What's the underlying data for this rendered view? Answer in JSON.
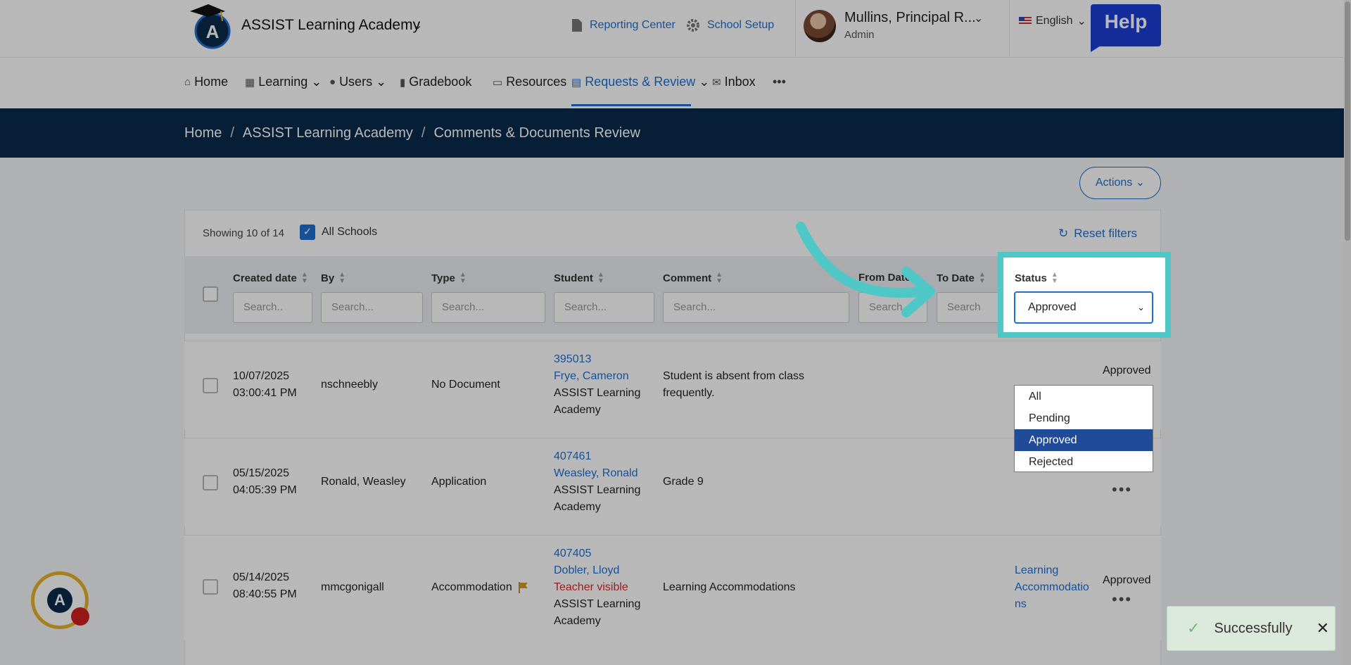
{
  "header": {
    "school_name": "ASSIST Learning Academy",
    "reporting_center": "Reporting Center",
    "school_setup": "School Setup",
    "user_name": "Mullins, Principal R...",
    "user_role": "Admin",
    "language": "English",
    "help": "Help"
  },
  "nav": {
    "home": "Home",
    "learning": "Learning",
    "users": "Users",
    "gradebook": "Gradebook",
    "resources": "Resources",
    "requests": "Requests & Review",
    "inbox": "Inbox",
    "more": "•••"
  },
  "breadcrumb": {
    "home": "Home",
    "school": "ASSIST Learning Academy",
    "page": "Comments & Documents Review",
    "sep": "/"
  },
  "toolbar": {
    "actions": "Actions",
    "showing": "Showing 10 of 14",
    "all_schools": "All Schools",
    "reset": "Reset filters"
  },
  "columns": {
    "created": "Created date",
    "by": "By",
    "type": "Type",
    "student": "Student",
    "comment": "Comment",
    "from_date": "From Date",
    "to_date": "To Date",
    "status": "Status"
  },
  "placeholders": {
    "created": "Search..",
    "by": "Search...",
    "type": "Search...",
    "student": "Search...",
    "comment": "Search...",
    "from_date": "Search...",
    "to_date": "Search"
  },
  "status_filter": {
    "value": "Approved",
    "options": [
      "All",
      "Pending",
      "Approved",
      "Rejected"
    ]
  },
  "rows": [
    {
      "date": "10/07/2025",
      "time": "03:00:41 PM",
      "by": "nschneebly",
      "type": "No Document",
      "student_id": "395013",
      "student_name": "Frye, Cameron",
      "school_line1": "ASSIST Learning",
      "school_line2": "Academy",
      "comment_line1": "Student is absent from class",
      "comment_line2": "frequently.",
      "status": "Approved"
    },
    {
      "date": "05/15/2025",
      "time": "04:05:39 PM",
      "by": "Ronald, Weasley",
      "type": "Application",
      "student_id": "407461",
      "student_name": "Weasley, Ronald",
      "school_line1": "ASSIST Learning",
      "school_line2": "Academy",
      "comment_line1": "Grade 9"
    },
    {
      "date": "05/14/2025",
      "time": "08:40:55 PM",
      "by": "mmcgonigall",
      "type": "Accommodation",
      "student_id": "407405",
      "student_name": "Dobler, Lloyd",
      "teacher_visible": "Teacher visible",
      "school_line1": "ASSIST Learning",
      "school_line2": "Academy",
      "comment_line1": "Learning Accommodations",
      "doc_line1": "Learning",
      "doc_line2": "Accommodatio",
      "doc_line3": "ns",
      "status": "Approved"
    }
  ],
  "toast": {
    "message": "Successfully"
  },
  "colors": {
    "accent": "#1f6fd1",
    "navy": "#0b2a4d",
    "highlight": "#50c7c7"
  }
}
